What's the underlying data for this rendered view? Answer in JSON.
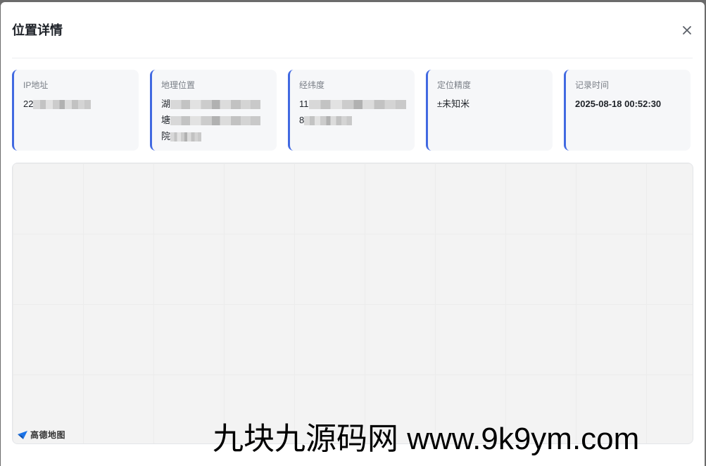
{
  "dialog": {
    "title": "位置详情",
    "close_label": "×"
  },
  "cards": [
    {
      "label": "IP地址",
      "lines": [
        "22"
      ]
    },
    {
      "label": "地理位置",
      "lines": [
        "湖",
        "塘",
        "院"
      ]
    },
    {
      "label": "经纬度",
      "lines": [
        "11",
        "8"
      ]
    },
    {
      "label": "定位精度",
      "lines": [
        "±未知米"
      ]
    },
    {
      "label": "记录时间",
      "lines": [
        "2025-08-18 00:52:30"
      ]
    }
  ],
  "map": {
    "provider_logo_text": "高德地图"
  },
  "watermark": {
    "text": "九块九源码网 www.9k9ym.com"
  },
  "colors": {
    "accent": "#4169e1",
    "card_bg": "#f6f7f9",
    "map_bg": "#f3f3f3"
  },
  "icons": {
    "close": "close-icon",
    "map_logo": "amap-logo-icon"
  }
}
